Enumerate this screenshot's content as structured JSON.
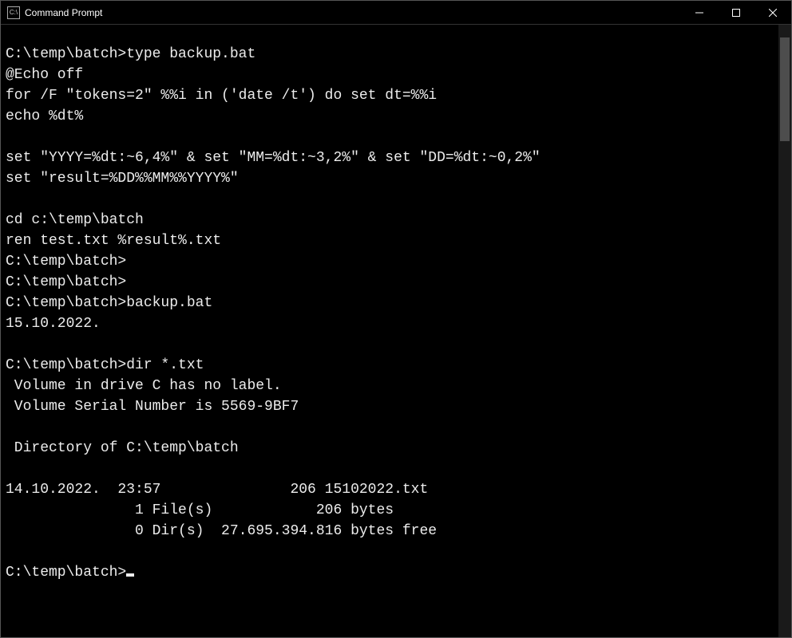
{
  "window": {
    "title": "Command Prompt"
  },
  "terminal": {
    "lines": [
      "C:\\temp\\batch>type backup.bat",
      "@Echo off",
      "for /F \"tokens=2\" %%i in ('date /t') do set dt=%%i",
      "echo %dt%",
      "",
      "set \"YYYY=%dt:~6,4%\" & set \"MM=%dt:~3,2%\" & set \"DD=%dt:~0,2%\"",
      "set \"result=%DD%%MM%%YYYY%\"",
      "",
      "cd c:\\temp\\batch",
      "ren test.txt %result%.txt",
      "C:\\temp\\batch>",
      "C:\\temp\\batch>",
      "C:\\temp\\batch>backup.bat",
      "15.10.2022.",
      "",
      "C:\\temp\\batch>dir *.txt",
      " Volume in drive C has no label.",
      " Volume Serial Number is 5569-9BF7",
      "",
      " Directory of C:\\temp\\batch",
      "",
      "14.10.2022.  23:57               206 15102022.txt",
      "               1 File(s)            206 bytes",
      "               0 Dir(s)  27.695.394.816 bytes free",
      "",
      "C:\\temp\\batch>"
    ],
    "show_cursor_on_last": true
  }
}
